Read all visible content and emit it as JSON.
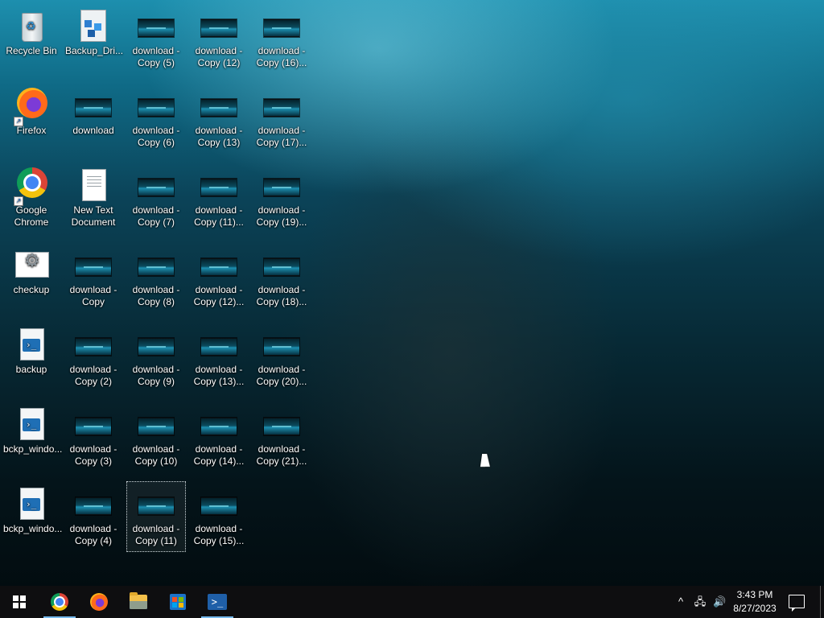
{
  "desktop": {
    "icons": {
      "recycle_bin": "Recycle Bin",
      "firefox": "Firefox",
      "chrome": "Google Chrome",
      "checkup": "checkup",
      "backup": "backup",
      "bckp1": "bckp_windo...",
      "bckp2": "bckp_windo...",
      "backup_drive": "Backup_Dri...",
      "download": "download",
      "new_text": "New Text Document",
      "dl_copy": "download - Copy",
      "dl_2": "download - Copy (2)",
      "dl_3": "download - Copy (3)",
      "dl_4": "download - Copy (4)",
      "dl_5": "download - Copy (5)",
      "dl_6": "download - Copy (6)",
      "dl_7": "download - Copy (7)",
      "dl_8": "download - Copy (8)",
      "dl_9": "download - Copy (9)",
      "dl_10": "download - Copy (10)",
      "dl_11": "download - Copy (11)",
      "dl_12": "download - Copy (12)",
      "dl_13": "download - Copy (13)",
      "dl_11b": "download - Copy (11)...",
      "dl_12b": "download - Copy (12)...",
      "dl_13b": "download - Copy (13)...",
      "dl_14": "download - Copy (14)...",
      "dl_15": "download - Copy (15)...",
      "dl_16": "download - Copy (16)...",
      "dl_17": "download - Copy (17)...",
      "dl_19": "download - Copy (19)...",
      "dl_18": "download - Copy (18)...",
      "dl_20": "download - Copy (20)...",
      "dl_21": "download - Copy (21)..."
    }
  },
  "taskbar": {
    "apps": [
      "start",
      "Google Chrome",
      "Firefox",
      "File Explorer",
      "Microsoft Store",
      "Windows PowerShell"
    ],
    "ps_glyph": ">_",
    "clock": {
      "time": "3:43 PM",
      "date": "8/27/2023"
    }
  }
}
